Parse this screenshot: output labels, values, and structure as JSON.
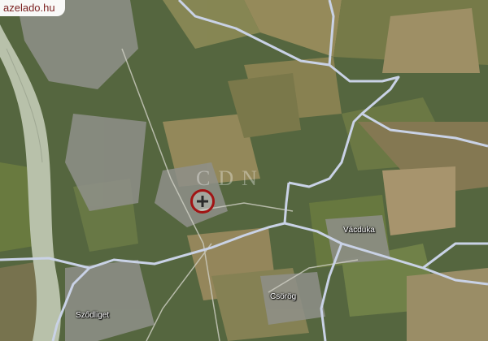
{
  "badge": {
    "text": "azelado.hu"
  },
  "watermark": {
    "text": "CDN"
  },
  "places": [
    {
      "name": "Vácduka"
    },
    {
      "name": "Csörög"
    },
    {
      "name": "Sződliget"
    }
  ],
  "colors": {
    "river": "#b8c1aa",
    "border": "#c9d2e6",
    "marker": "#a11414"
  },
  "marker": {
    "icon": "location-target-icon"
  }
}
